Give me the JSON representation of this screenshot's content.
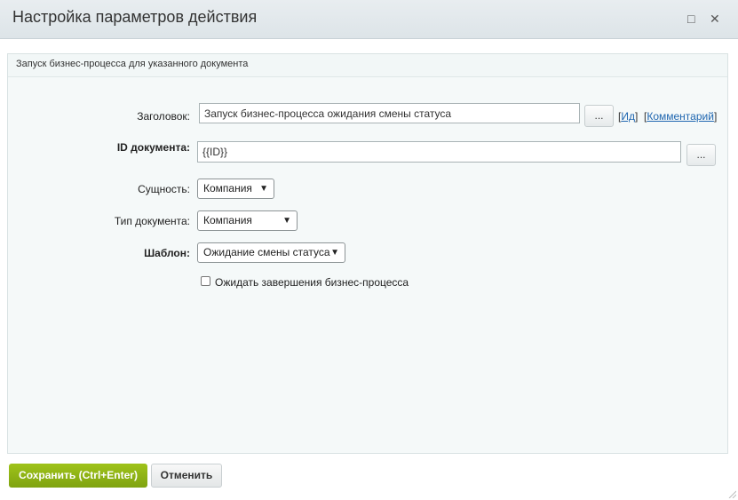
{
  "dialog": {
    "title": "Настройка параметров действия",
    "maximize_glyph": "□",
    "close_glyph": "✕"
  },
  "panel": {
    "title": "Запуск бизнес-процесса для указанного документа"
  },
  "form": {
    "title_label": "Заголовок:",
    "title_value": "Запуск бизнес-процесса ожидания смены статуса",
    "title_dots": "...",
    "link_id": "Ид",
    "link_comment": "Комментарий",
    "doc_id_label": "ID документа:",
    "doc_id_value": "{{ID}}",
    "doc_id_dots": "...",
    "entity_label": "Сущность:",
    "entity_value": "Компания",
    "doctype_label": "Тип документа:",
    "doctype_value": "Компания",
    "template_label": "Шаблон:",
    "template_value": "Ожидание смены статуса",
    "wait_label": "Ожидать завершения бизнес-процесса",
    "wait_checked": false
  },
  "footer": {
    "save_label": "Сохранить (Ctrl+Enter)",
    "cancel_label": "Отменить"
  },
  "colors": {
    "save_button": "#8db515",
    "link": "#2067b0"
  }
}
